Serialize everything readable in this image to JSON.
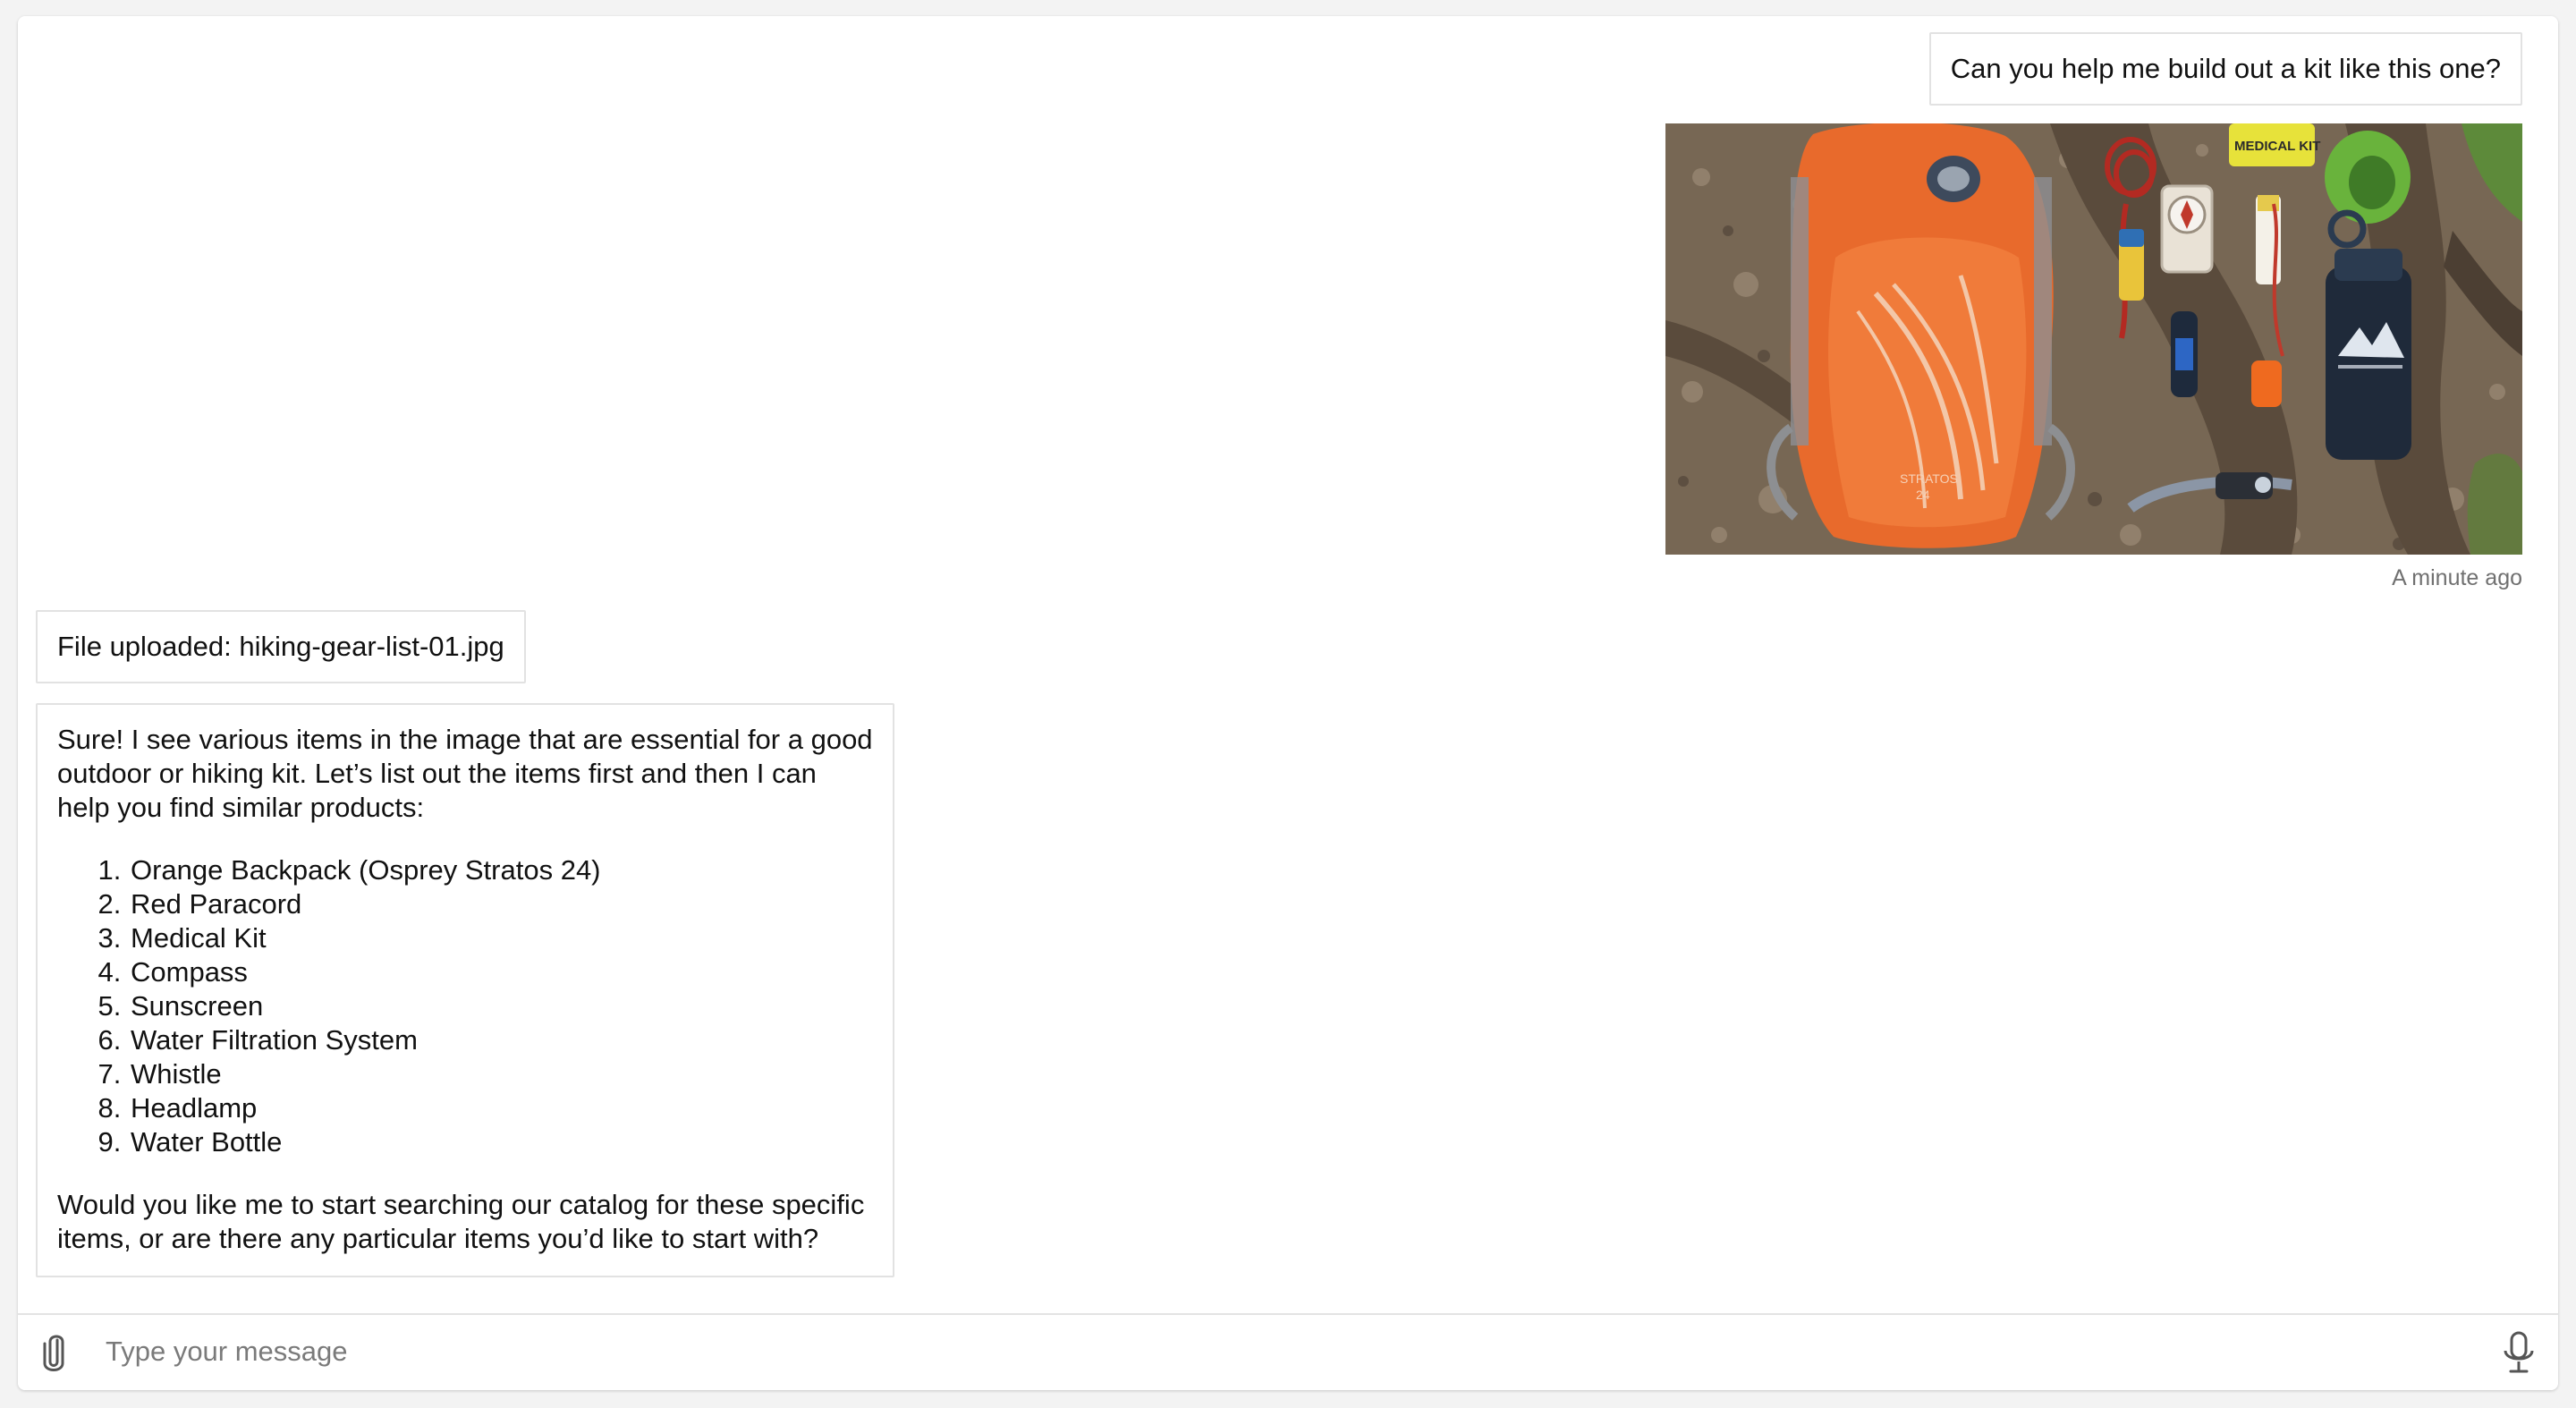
{
  "conversation": {
    "user_message": "Can you help me build out a kit like this one?",
    "image_alt": "Hiking gear laid out on the ground: orange backpack, paracord, medical kit, compass, sunscreen, water filter, whistle, headlamp and water bottle",
    "image_texts": {
      "backpack_brand": "STRATOS",
      "backpack_size": "24",
      "medkit_label": "MEDICAL KIT"
    },
    "timestamp": "A minute ago",
    "file_uploaded": "File uploaded: hiking-gear-list-01.jpg",
    "reply": {
      "intro": "Sure! I see various items in the image that are essential for a good outdoor or hiking kit. Let’s list out the items first and then I can help you find similar products:",
      "items": [
        "Orange Backpack (Osprey Stratos 24)",
        "Red Paracord",
        "Medical Kit",
        "Compass",
        "Sunscreen",
        "Water Filtration System",
        "Whistle",
        "Headlamp",
        "Water Bottle"
      ],
      "outro": "Would you like me to start searching our catalog for these specific items, or are there any particular items you’d like to start with?"
    }
  },
  "composer": {
    "placeholder": "Type your message",
    "attach_icon": "paperclip-icon",
    "mic_icon": "microphone-icon"
  },
  "colors": {
    "backpack_orange": "#e86a2c",
    "bubble_border": "#e2e2e2",
    "timestamp_gray": "#707070"
  }
}
